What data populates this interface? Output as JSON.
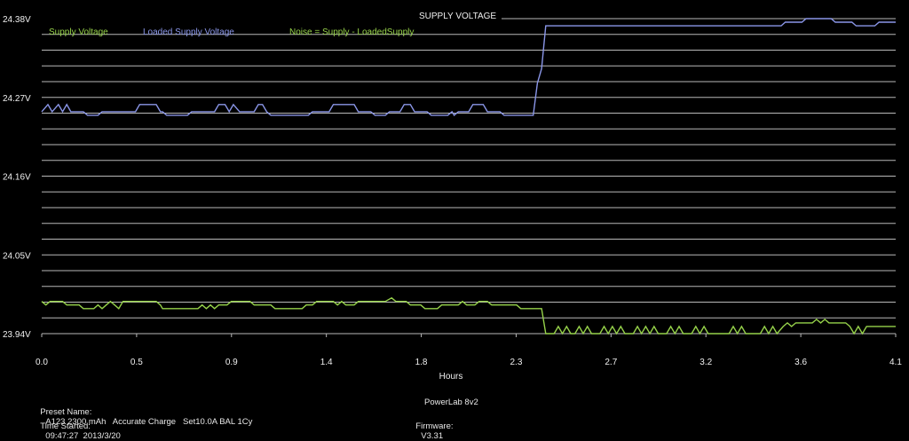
{
  "chart_data": {
    "type": "line",
    "title": "SUPPLY VOLTAGE",
    "xlabel": "Hours",
    "ylabel": "",
    "xlim": [
      0,
      4.1
    ],
    "ylim": [
      23.94,
      24.38
    ],
    "x_ticks": [
      "0.0",
      "0.5",
      "0.9",
      "1.4",
      "1.8",
      "2.3",
      "2.7",
      "3.2",
      "3.6",
      "4.1"
    ],
    "y_ticks": [
      "24.38V",
      "24.27V",
      "24.16V",
      "24.05V",
      "23.94V"
    ],
    "legend": [
      "Supply Voltage",
      "Loaded Supply Voltage",
      "Noise = Supply - LoadedSupply"
    ],
    "grid": true,
    "series": [
      {
        "name": "Loaded Supply Voltage",
        "color": "#8a96e8",
        "points": [
          [
            0.0,
            24.25
          ],
          [
            0.03,
            24.26
          ],
          [
            0.05,
            24.25
          ],
          [
            0.08,
            24.26
          ],
          [
            0.1,
            24.25
          ],
          [
            0.12,
            24.26
          ],
          [
            0.14,
            24.25
          ],
          [
            0.2,
            24.25
          ],
          [
            0.22,
            24.245
          ],
          [
            0.27,
            24.245
          ],
          [
            0.29,
            24.25
          ],
          [
            0.45,
            24.25
          ],
          [
            0.47,
            24.26
          ],
          [
            0.55,
            24.26
          ],
          [
            0.57,
            24.25
          ],
          [
            0.58,
            24.25
          ],
          [
            0.6,
            24.245
          ],
          [
            0.7,
            24.245
          ],
          [
            0.72,
            24.25
          ],
          [
            0.83,
            24.25
          ],
          [
            0.85,
            24.26
          ],
          [
            0.88,
            24.26
          ],
          [
            0.9,
            24.25
          ],
          [
            0.92,
            24.26
          ],
          [
            0.95,
            24.25
          ],
          [
            1.02,
            24.25
          ],
          [
            1.04,
            24.26
          ],
          [
            1.06,
            24.26
          ],
          [
            1.08,
            24.25
          ],
          [
            1.1,
            24.245
          ],
          [
            1.28,
            24.245
          ],
          [
            1.3,
            24.25
          ],
          [
            1.38,
            24.25
          ],
          [
            1.4,
            24.26
          ],
          [
            1.5,
            24.26
          ],
          [
            1.52,
            24.25
          ],
          [
            1.58,
            24.25
          ],
          [
            1.6,
            24.245
          ],
          [
            1.65,
            24.245
          ],
          [
            1.67,
            24.25
          ],
          [
            1.72,
            24.25
          ],
          [
            1.74,
            24.26
          ],
          [
            1.77,
            24.26
          ],
          [
            1.79,
            24.25
          ],
          [
            1.85,
            24.25
          ],
          [
            1.87,
            24.245
          ],
          [
            1.95,
            24.245
          ],
          [
            1.97,
            24.25
          ],
          [
            1.98,
            24.245
          ],
          [
            2.0,
            24.25
          ],
          [
            2.05,
            24.25
          ],
          [
            2.07,
            24.26
          ],
          [
            2.12,
            24.26
          ],
          [
            2.14,
            24.25
          ],
          [
            2.2,
            24.25
          ],
          [
            2.22,
            24.245
          ],
          [
            2.36,
            24.245
          ],
          [
            2.38,
            24.29
          ],
          [
            2.4,
            24.31
          ],
          [
            2.42,
            24.37
          ],
          [
            3.55,
            24.37
          ],
          [
            3.57,
            24.375
          ],
          [
            3.65,
            24.375
          ],
          [
            3.67,
            24.38
          ],
          [
            3.79,
            24.38
          ],
          [
            3.81,
            24.375
          ],
          [
            3.89,
            24.375
          ],
          [
            3.91,
            24.37
          ],
          [
            4.0,
            24.37
          ],
          [
            4.02,
            24.375
          ],
          [
            4.1,
            24.375
          ]
        ]
      },
      {
        "name": "Supply Voltage",
        "color": "#96d24a",
        "points": [
          [
            0.0,
            23.985
          ],
          [
            0.02,
            23.98
          ],
          [
            0.04,
            23.985
          ],
          [
            0.1,
            23.985
          ],
          [
            0.12,
            23.98
          ],
          [
            0.18,
            23.98
          ],
          [
            0.2,
            23.975
          ],
          [
            0.25,
            23.975
          ],
          [
            0.27,
            23.98
          ],
          [
            0.29,
            23.975
          ],
          [
            0.31,
            23.98
          ],
          [
            0.33,
            23.985
          ],
          [
            0.35,
            23.98
          ],
          [
            0.37,
            23.975
          ],
          [
            0.39,
            23.985
          ],
          [
            0.55,
            23.985
          ],
          [
            0.57,
            23.98
          ],
          [
            0.58,
            23.975
          ],
          [
            0.75,
            23.975
          ],
          [
            0.77,
            23.98
          ],
          [
            0.79,
            23.975
          ],
          [
            0.81,
            23.98
          ],
          [
            0.83,
            23.975
          ],
          [
            0.85,
            23.98
          ],
          [
            0.89,
            23.98
          ],
          [
            0.91,
            23.985
          ],
          [
            1.0,
            23.985
          ],
          [
            1.02,
            23.98
          ],
          [
            1.1,
            23.98
          ],
          [
            1.12,
            23.975
          ],
          [
            1.25,
            23.975
          ],
          [
            1.27,
            23.98
          ],
          [
            1.3,
            23.98
          ],
          [
            1.32,
            23.985
          ],
          [
            1.4,
            23.985
          ],
          [
            1.42,
            23.98
          ],
          [
            1.44,
            23.985
          ],
          [
            1.46,
            23.98
          ],
          [
            1.5,
            23.98
          ],
          [
            1.52,
            23.985
          ],
          [
            1.65,
            23.985
          ],
          [
            1.68,
            23.99
          ],
          [
            1.7,
            23.985
          ],
          [
            1.75,
            23.985
          ],
          [
            1.77,
            23.98
          ],
          [
            1.82,
            23.98
          ],
          [
            1.84,
            23.975
          ],
          [
            1.9,
            23.975
          ],
          [
            1.92,
            23.98
          ],
          [
            2.0,
            23.98
          ],
          [
            2.02,
            23.985
          ],
          [
            2.04,
            23.98
          ],
          [
            2.08,
            23.98
          ],
          [
            2.1,
            23.985
          ],
          [
            2.14,
            23.985
          ],
          [
            2.16,
            23.98
          ],
          [
            2.28,
            23.98
          ],
          [
            2.3,
            23.975
          ],
          [
            2.4,
            23.975
          ],
          [
            2.42,
            23.94
          ],
          [
            2.46,
            23.94
          ],
          [
            2.48,
            23.95
          ],
          [
            2.5,
            23.94
          ],
          [
            2.52,
            23.95
          ],
          [
            2.54,
            23.94
          ],
          [
            2.56,
            23.94
          ],
          [
            2.58,
            23.95
          ],
          [
            2.6,
            23.94
          ],
          [
            2.62,
            23.95
          ],
          [
            2.64,
            23.94
          ],
          [
            2.68,
            23.94
          ],
          [
            2.7,
            23.95
          ],
          [
            2.72,
            23.94
          ],
          [
            2.74,
            23.95
          ],
          [
            2.76,
            23.94
          ],
          [
            2.78,
            23.95
          ],
          [
            2.8,
            23.94
          ],
          [
            2.84,
            23.94
          ],
          [
            2.86,
            23.95
          ],
          [
            2.88,
            23.94
          ],
          [
            2.9,
            23.95
          ],
          [
            2.92,
            23.94
          ],
          [
            2.94,
            23.95
          ],
          [
            2.96,
            23.94
          ],
          [
            3.0,
            23.94
          ],
          [
            3.02,
            23.95
          ],
          [
            3.04,
            23.94
          ],
          [
            3.06,
            23.95
          ],
          [
            3.08,
            23.94
          ],
          [
            3.12,
            23.94
          ],
          [
            3.14,
            23.95
          ],
          [
            3.16,
            23.94
          ],
          [
            3.18,
            23.95
          ],
          [
            3.2,
            23.94
          ],
          [
            3.3,
            23.94
          ],
          [
            3.32,
            23.95
          ],
          [
            3.34,
            23.94
          ],
          [
            3.36,
            23.95
          ],
          [
            3.38,
            23.94
          ],
          [
            3.45,
            23.94
          ],
          [
            3.47,
            23.95
          ],
          [
            3.49,
            23.94
          ],
          [
            3.51,
            23.95
          ],
          [
            3.53,
            23.94
          ],
          [
            3.56,
            23.95
          ],
          [
            3.58,
            23.955
          ],
          [
            3.6,
            23.95
          ],
          [
            3.62,
            23.955
          ],
          [
            3.7,
            23.955
          ],
          [
            3.72,
            23.96
          ],
          [
            3.74,
            23.955
          ],
          [
            3.76,
            23.96
          ],
          [
            3.78,
            23.955
          ],
          [
            3.86,
            23.955
          ],
          [
            3.88,
            23.95
          ],
          [
            3.9,
            23.94
          ],
          [
            3.92,
            23.95
          ],
          [
            3.94,
            23.94
          ],
          [
            3.96,
            23.95
          ],
          [
            4.1,
            23.95
          ]
        ]
      }
    ]
  },
  "footer": {
    "preset_label": "Preset Name:",
    "preset_value": "A123 2300 mAh   Accurate Charge   Set10.0A BAL 1Cy",
    "time_label": "Time Started:",
    "time_value": "09:47:27  2013/3/20",
    "device_label": "PowerLab 8v2",
    "firmware_label": "Firmware:",
    "firmware_value": "V3.31"
  }
}
